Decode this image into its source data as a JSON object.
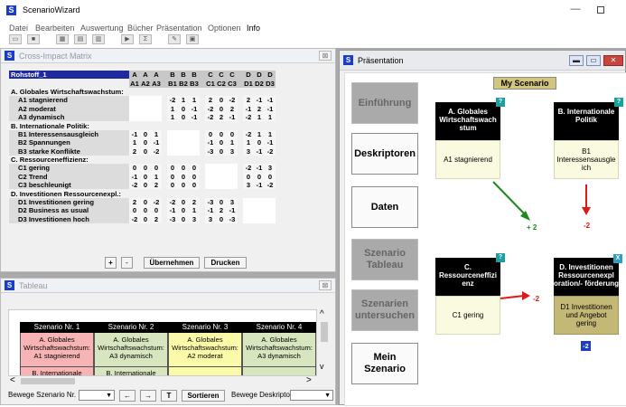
{
  "app": {
    "title": "ScenarioWizard",
    "icon": "S",
    "min": "—"
  },
  "menu": [
    "Datei",
    "Bearbeiten",
    "Auswertung",
    "Bücher",
    "Präsentation",
    "Optionen",
    "Info"
  ],
  "cim": {
    "title": "Cross-Impact Matrix",
    "corner": "Rohstoff_1",
    "col_groups": [
      "A",
      "A",
      "A",
      "B",
      "B",
      "B",
      "C",
      "C",
      "C",
      "D",
      "D",
      "D"
    ],
    "col_labels": [
      "A1",
      "A2",
      "A3",
      "B1",
      "B2",
      "B3",
      "C1",
      "C2",
      "C3",
      "D1",
      "D2",
      "D3"
    ],
    "rows": [
      {
        "type": "section",
        "label": "A. Globales Wirtschaftswachstum:"
      },
      {
        "type": "item",
        "label": "A1 stagnierend",
        "v": [
          "",
          "",
          "",
          "-2",
          "1",
          "1",
          "2",
          "0",
          "-2",
          "2",
          "-1",
          "-1"
        ]
      },
      {
        "type": "item",
        "label": "A2 moderat",
        "v": [
          "",
          "",
          "",
          "1",
          "0",
          "-1",
          "-2",
          "0",
          "2",
          "-1",
          "2",
          "-1"
        ]
      },
      {
        "type": "item",
        "label": "A3 dynamisch",
        "v": [
          "",
          "",
          "",
          "1",
          "0",
          "-1",
          "-2",
          "2",
          "-1",
          "-2",
          "1",
          "1"
        ]
      },
      {
        "type": "section",
        "label": "B. Internationale Politik:"
      },
      {
        "type": "item",
        "label": "B1 Interessensausgleich",
        "v": [
          "-1",
          "0",
          "1",
          "",
          "",
          "",
          "0",
          "0",
          "0",
          "-2",
          "1",
          "1"
        ]
      },
      {
        "type": "item",
        "label": "B2 Spannungen",
        "v": [
          "1",
          "0",
          "-1",
          "",
          "",
          "",
          "-1",
          "0",
          "1",
          "1",
          "0",
          "-1"
        ]
      },
      {
        "type": "item",
        "label": "B3 starke Konflikte",
        "v": [
          "2",
          "0",
          "-2",
          "",
          "",
          "",
          "-3",
          "0",
          "3",
          "3",
          "-1",
          "-2"
        ]
      },
      {
        "type": "section",
        "label": "C. Ressourceneffizienz:"
      },
      {
        "type": "item",
        "label": "C1 gering",
        "v": [
          "0",
          "0",
          "0",
          "0",
          "0",
          "0",
          "",
          "",
          "",
          "-2",
          "-1",
          "3"
        ]
      },
      {
        "type": "item",
        "label": "C2 Trend",
        "v": [
          "-1",
          "0",
          "1",
          "0",
          "0",
          "0",
          "",
          "",
          "",
          "0",
          "0",
          "0"
        ]
      },
      {
        "type": "item",
        "label": "C3 beschleunigt",
        "v": [
          "-2",
          "0",
          "2",
          "0",
          "0",
          "0",
          "",
          "",
          "",
          "3",
          "-1",
          "-2"
        ]
      },
      {
        "type": "section",
        "label": "D. Investitionen Ressourcenexpl.:"
      },
      {
        "type": "item",
        "label": "D1 Investitionen gering",
        "v": [
          "2",
          "0",
          "-2",
          "-2",
          "0",
          "2",
          "-3",
          "0",
          "3",
          "",
          "",
          ""
        ]
      },
      {
        "type": "item",
        "label": "D2 Business as usual",
        "v": [
          "0",
          "0",
          "0",
          "-1",
          "0",
          "1",
          "-1",
          "2",
          "-1",
          "",
          "",
          ""
        ]
      },
      {
        "type": "item",
        "label": "D3 Investitionen hoch",
        "v": [
          "-2",
          "0",
          "2",
          "-3",
          "0",
          "3",
          "3",
          "0",
          "-3",
          "",
          "",
          ""
        ]
      }
    ],
    "btn_plus": "+",
    "btn_minus": "-",
    "btn_apply": "Übernehmen",
    "btn_print": "Drucken"
  },
  "tableau": {
    "title": "Tableau",
    "scenarios": [
      {
        "head": "Szenario Nr. 1",
        "cell": "A. Globales Wirtschaftswachstum: A1 stagnierend",
        "cell2": "B. Internationale",
        "color": "#f8b4b4"
      },
      {
        "head": "Szenario Nr. 2",
        "cell": "A. Globales Wirtschaftswachstum: A3 dynamisch",
        "cell2": "B. Internationale",
        "color": "#d8e6c0"
      },
      {
        "head": "Szenario Nr. 3",
        "cell": "A. Globales Wirtschaftswachstum: A2 moderat",
        "cell2": "",
        "color": "#fafaa8"
      },
      {
        "head": "Szenario Nr. 4",
        "cell": "A. Globales Wirtschaftswachstum: A3 dynamisch",
        "cell2": "",
        "color": "#d8e6c0"
      }
    ],
    "move_scenario_label": "Bewege Szenario Nr.",
    "move_descriptor_label": "Bewege Deskriptor",
    "btn_left": "←",
    "btn_right": "→",
    "btn_T": "T",
    "btn_sort": "Sortieren"
  },
  "pres": {
    "title": "Präsentation",
    "nav": [
      {
        "label": "Einführung",
        "enabled": false
      },
      {
        "label": "Deskriptoren",
        "enabled": true
      },
      {
        "label": "Daten",
        "enabled": true
      },
      {
        "label": "Szenario Tableau",
        "enabled": false
      },
      {
        "label": "Szenarien untersuchen",
        "enabled": false
      },
      {
        "label": "Mein Szenario",
        "enabled": true
      }
    ],
    "scenario_title": "My Scenario",
    "cards": {
      "a": {
        "head": "A. Globales Wirtschaftswach stum",
        "value": "A1 stagnierend",
        "badge": "?"
      },
      "b": {
        "head": "B. Internationale Politik",
        "value": "B1 Interessensausgle ich",
        "badge": "?"
      },
      "c": {
        "head": "C. Ressourceneffizi enz",
        "value": "C1 gering",
        "badge": "?"
      },
      "d": {
        "head": "D. Investitionen Ressourcenexpl oration/- förderung",
        "value": "D1 Investitionen und Angebot gering",
        "badge": "X"
      }
    },
    "impacts": {
      "a_to_c": "+ 2",
      "b_down": "-2",
      "c_to_d": "-2",
      "d_bottom": "-2"
    },
    "colors": {
      "positive": "#1a8a1a",
      "negative": "#e01818"
    }
  }
}
